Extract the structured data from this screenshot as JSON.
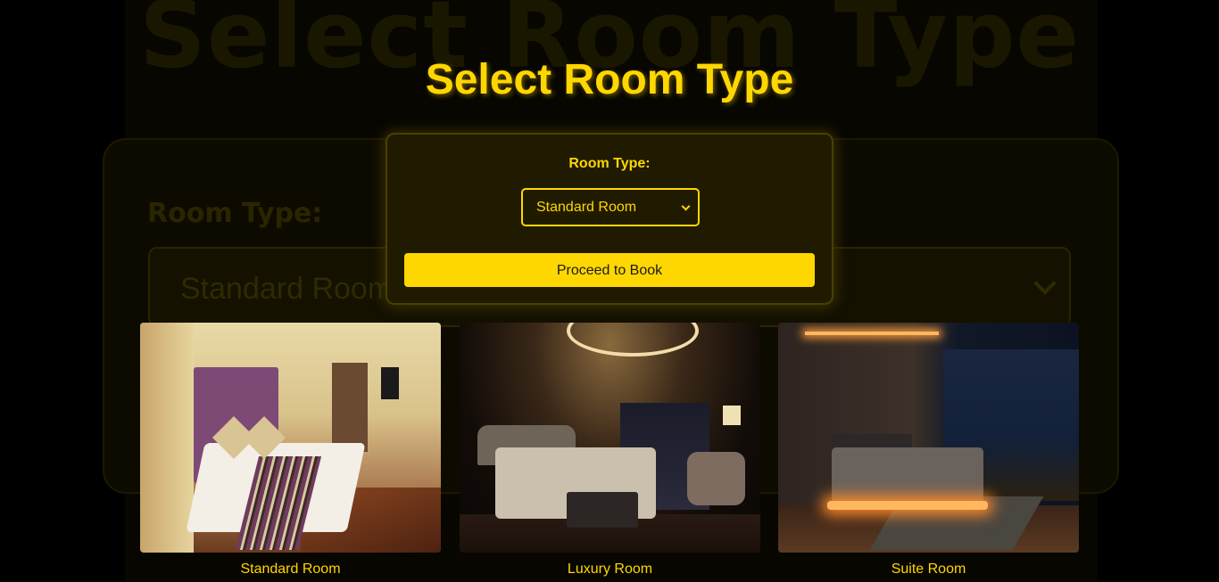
{
  "page": {
    "title": "Select Room Type",
    "background_color": "#000000",
    "accent_color": "#ffd700"
  },
  "form": {
    "label": "Room Type:",
    "select_value": "Standard Room",
    "submit_label": "Proceed to Book"
  },
  "rooms": [
    {
      "name": "Standard Room"
    },
    {
      "name": "Luxury Room"
    },
    {
      "name": "Suite Room"
    }
  ]
}
